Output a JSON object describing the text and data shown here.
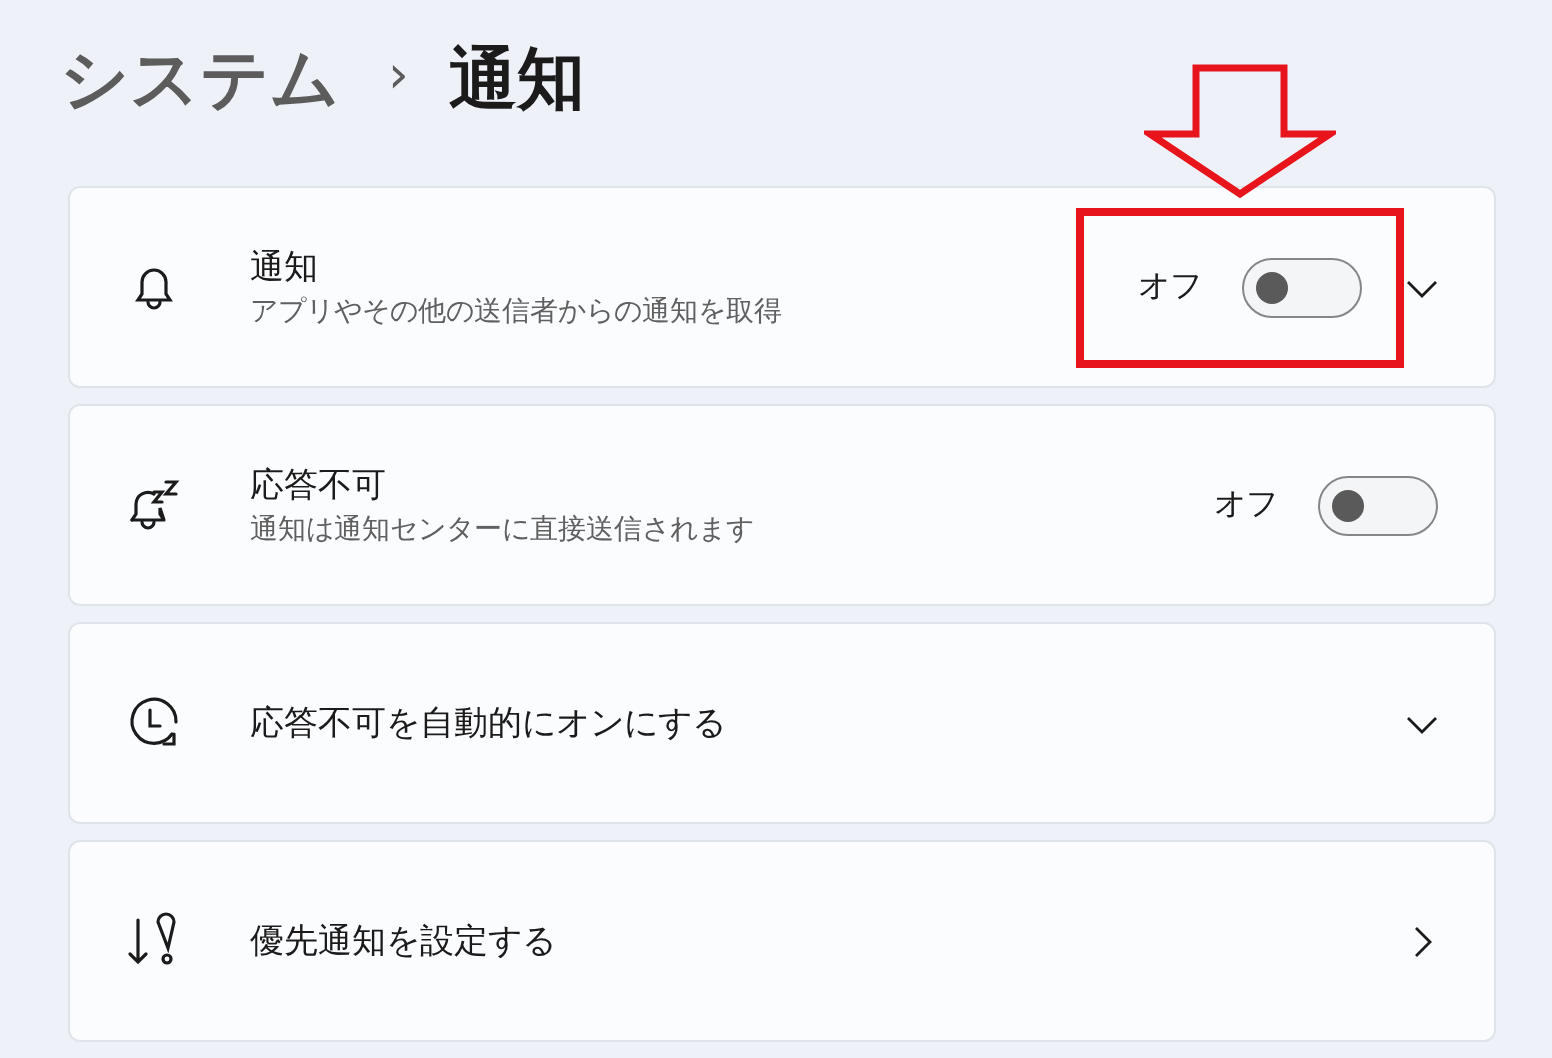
{
  "breadcrumb": {
    "parent": "システム",
    "separator": "›",
    "current": "通知"
  },
  "rows": [
    {
      "kind": "toggle_expand",
      "title": "通知",
      "subtitle": "アプリやその他の送信者からの通知を取得",
      "state_label": "オフ",
      "on": false,
      "highlighted": true
    },
    {
      "kind": "toggle",
      "title": "応答不可",
      "subtitle": "通知は通知センターに直接送信されます",
      "state_label": "オフ",
      "on": false,
      "highlighted": false
    },
    {
      "kind": "expand",
      "title": "応答不可を自動的にオンにする",
      "highlighted": false
    },
    {
      "kind": "link",
      "title": "優先通知を設定する",
      "highlighted": false
    }
  ]
}
